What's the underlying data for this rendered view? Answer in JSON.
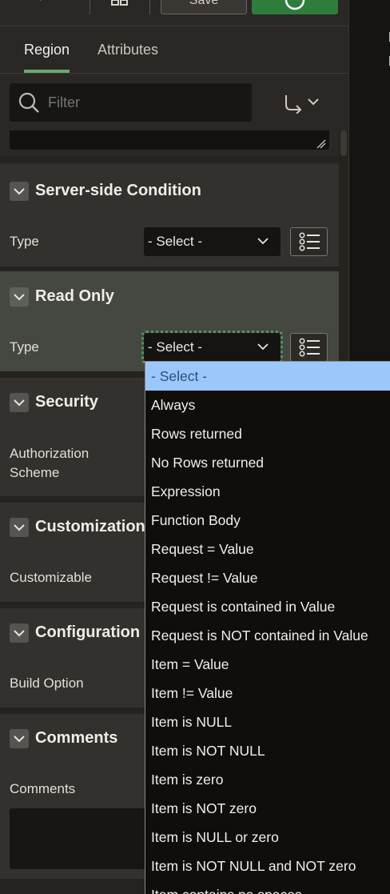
{
  "toolbar": {
    "save_label": "Save"
  },
  "tabs": [
    {
      "label": "Region"
    },
    {
      "label": "Attributes"
    }
  ],
  "filter": {
    "placeholder": "Filter"
  },
  "sections": {
    "server_side_condition": {
      "title": "Server-side Condition",
      "type_label": "Type",
      "type_value": "- Select -"
    },
    "read_only": {
      "title": "Read Only",
      "type_label": "Type",
      "type_value": "- Select -"
    },
    "security": {
      "title": "Security",
      "field_label": "Authorization Scheme"
    },
    "customization": {
      "title": "Customization",
      "field_label": "Customizable"
    },
    "configuration": {
      "title": "Configuration",
      "field_label": "Build Option"
    },
    "comments": {
      "title": "Comments",
      "field_label": "Comments"
    }
  },
  "dropdown": {
    "options": [
      "- Select -",
      "Always",
      "Rows returned",
      "No Rows returned",
      "Expression",
      "Function Body",
      "Request = Value",
      "Request != Value",
      "Request is contained in Value",
      "Request is NOT contained in Value",
      "Item = Value",
      "Item != Value",
      "Item is NULL",
      "Item is NOT NULL",
      "Item is zero",
      "Item is NOT zero",
      "Item is NULL or zero",
      "Item is NOT NULL and NOT zero",
      "Item contains no spaces"
    ],
    "selected_index": 0
  },
  "colors": {
    "accent_green": "#2f7d3c",
    "tab_underline": "#6aa86f",
    "selected_option": "#9cc7fb",
    "focus_outline": "#4e9a5a"
  }
}
